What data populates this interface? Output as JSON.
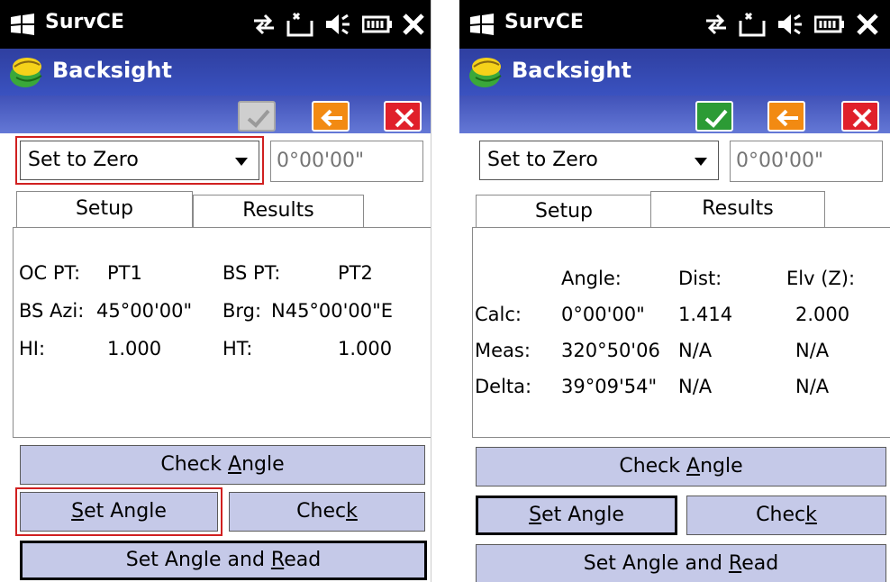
{
  "left": {
    "status": {
      "app_name": "SurvCE"
    },
    "title": "Backsight",
    "dropdown": {
      "selected": "Set to Zero"
    },
    "angle_field": {
      "placeholder": "0°00'00\""
    },
    "tabs": {
      "setup": "Setup",
      "results": "Results",
      "active": "Setup"
    },
    "setup": {
      "oc_pt_label": "OC PT:",
      "oc_pt_value": "PT1",
      "bs_pt_label": "BS PT:",
      "bs_pt_value": "PT2",
      "bs_azi_label": "BS Azi:",
      "bs_azi_value": "45°00'00\"",
      "brg_label": "Brg:",
      "brg_value": "N45°00'00\"E",
      "hi_label": "HI:",
      "hi_value": "1.000",
      "ht_label": "HT:",
      "ht_value": "1.000"
    },
    "buttons": {
      "check_angle_pre": "Check ",
      "check_angle_ul": "A",
      "check_angle_post": "ngle",
      "set_angle_pre": "",
      "set_angle_ul": "S",
      "set_angle_post": "et Angle",
      "check_pre": "Chec",
      "check_ul": "k",
      "check_post": "",
      "set_read_pre": "Set Angle and ",
      "set_read_ul": "R",
      "set_read_post": "ead"
    },
    "accept_enabled": false
  },
  "right": {
    "status": {
      "app_name": "SurvCE"
    },
    "title": "Backsight",
    "dropdown": {
      "selected": "Set to Zero"
    },
    "angle_field": {
      "placeholder": "0°00'00\""
    },
    "tabs": {
      "setup": "Setup",
      "results": "Results",
      "active": "Results"
    },
    "results": {
      "headers": [
        "Angle:",
        "Dist:",
        "Elv (Z):"
      ],
      "rows": [
        {
          "label": "Calc:",
          "angle": "0°00'00\"",
          "dist": "1.414",
          "elv": "2.000"
        },
        {
          "label": "Meas:",
          "angle": "320°50'06",
          "dist": "N/A",
          "elv": "N/A"
        },
        {
          "label": "Delta:",
          "angle": "39°09'54\"",
          "dist": "N/A",
          "elv": "N/A"
        }
      ]
    },
    "buttons": {
      "check_angle_pre": "Check ",
      "check_angle_ul": "A",
      "check_angle_post": "ngle",
      "set_angle_pre": "",
      "set_angle_ul": "S",
      "set_angle_post": "et Angle",
      "check_pre": "Chec",
      "check_ul": "k",
      "check_post": "",
      "set_read_pre": "Set Angle and ",
      "set_read_ul": "R",
      "set_read_post": "ead"
    },
    "accept_enabled": true
  },
  "icons": {
    "windows_logo": "windows-logo-icon",
    "connectivity": "sync-arrows-icon",
    "no_signal": "no-signal-icon",
    "volume": "volume-icon",
    "battery": "battery-icon",
    "close": "close-icon",
    "app_logo": "survce-logo-icon",
    "accept": "checkmark-icon",
    "back": "back-arrow-icon",
    "cancel": "x-icon"
  },
  "colors": {
    "title_bar": "#2f3fa0",
    "action_bar": "#4f63c8",
    "button_fill": "#c5c9e8",
    "accept_green": "#2c9b35",
    "back_orange": "#f28a12",
    "cancel_red": "#e0202a",
    "highlight_red": "#d02020"
  }
}
